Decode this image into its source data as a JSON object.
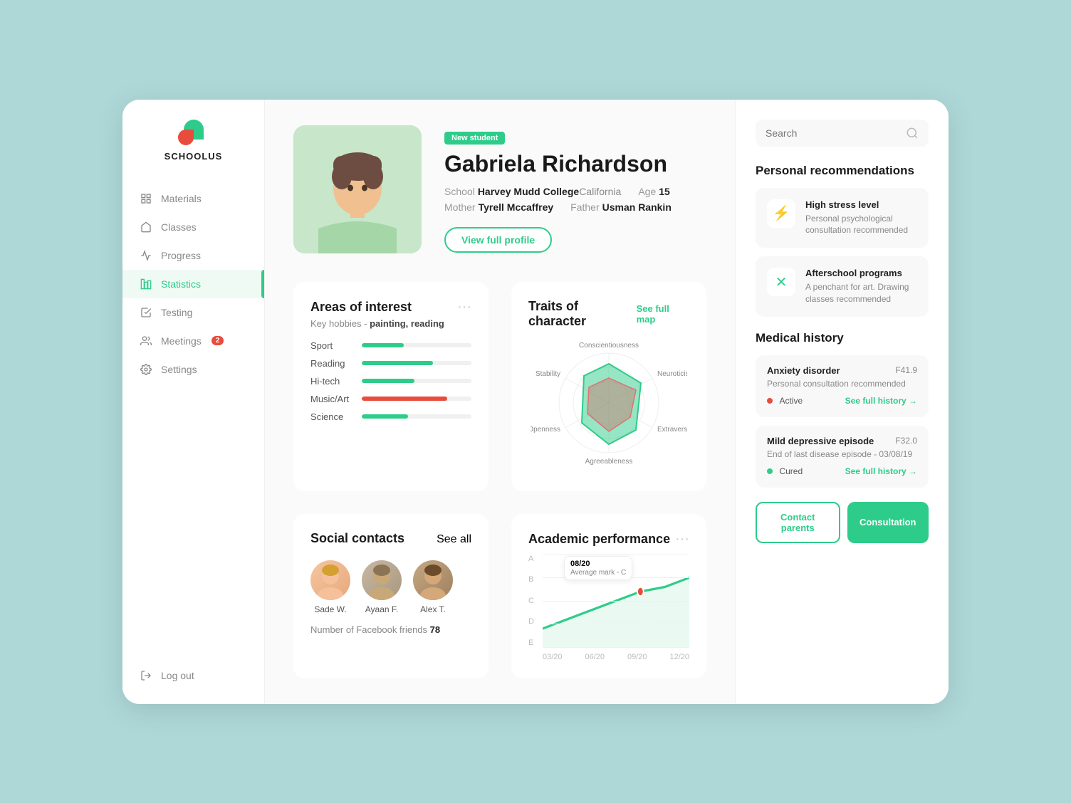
{
  "app": {
    "name": "SCHOOLUS"
  },
  "sidebar": {
    "items": [
      {
        "id": "materials",
        "label": "Materials",
        "active": false,
        "badge": null
      },
      {
        "id": "classes",
        "label": "Classes",
        "active": false,
        "badge": null
      },
      {
        "id": "progress",
        "label": "Progress",
        "active": false,
        "badge": null
      },
      {
        "id": "statistics",
        "label": "Statistics",
        "active": true,
        "badge": null
      },
      {
        "id": "testing",
        "label": "Testing",
        "active": false,
        "badge": null
      },
      {
        "id": "meetings",
        "label": "Meetings",
        "active": false,
        "badge": "2"
      },
      {
        "id": "settings",
        "label": "Settings",
        "active": false,
        "badge": null
      }
    ],
    "logout_label": "Log out"
  },
  "student": {
    "badge": "New student",
    "name": "Gabriela Richardson",
    "school_label": "School",
    "school": "Harvey Mudd College",
    "location": "California",
    "age_label": "Age",
    "age": "15",
    "mother_label": "Mother",
    "mother": "Tyrell Mccaffrey",
    "father_label": "Father",
    "father": "Usman Rankin",
    "view_profile_label": "View full profile"
  },
  "areas_of_interest": {
    "title": "Areas of interest",
    "hobbies_label": "Key hobbies",
    "hobbies": "painting, reading",
    "bars": [
      {
        "label": "Sport",
        "pct": 38,
        "color": "#2ecc8a"
      },
      {
        "label": "Reading",
        "pct": 65,
        "color": "#2ecc8a"
      },
      {
        "label": "Hi-tech",
        "pct": 48,
        "color": "#2ecc8a"
      },
      {
        "label": "Music/Art",
        "pct": 78,
        "color": "#e74c3c"
      },
      {
        "label": "Science",
        "pct": 42,
        "color": "#2ecc8a"
      }
    ]
  },
  "traits": {
    "title": "Traits of character",
    "see_full_map": "See full map",
    "labels": [
      "Conscientiousness",
      "Neuroticism",
      "Extraversion",
      "Agreeableness",
      "Openness",
      "Stability"
    ]
  },
  "social": {
    "title": "Social contacts",
    "see_all": "See all",
    "contacts": [
      {
        "name": "Sade W."
      },
      {
        "name": "Ayaan F."
      },
      {
        "name": "Alex T."
      }
    ],
    "facebook_label": "Number of Facebook friends",
    "facebook_count": "78"
  },
  "academic": {
    "title": "Academic performance",
    "mark": "08/20",
    "average_label": "Average mark",
    "average": "C",
    "x_labels": [
      "03/20",
      "06/20",
      "09/20",
      "12/20"
    ],
    "y_labels": [
      "A",
      "B",
      "C",
      "D",
      "E"
    ]
  },
  "right_panel": {
    "search_placeholder": "Search",
    "recommendations_title": "Personal recommendations",
    "recommendations": [
      {
        "id": "stress",
        "icon": "⚡",
        "title": "High stress level",
        "desc": "Personal psychological consultation recommended"
      },
      {
        "id": "afterschool",
        "icon": "✕",
        "title": "Afterschool programs",
        "desc": "A penchant for art. Drawing classes recommended"
      }
    ],
    "medical_title": "Medical history",
    "medical_records": [
      {
        "title": "Anxiety disorder",
        "code": "F41.9",
        "desc": "Personal consultation recommended",
        "status": "Active",
        "status_type": "active",
        "history_link": "See full history →"
      },
      {
        "title": "Mild depressive episode",
        "code": "F32.0",
        "desc": "End of last disease episode - 03/08/19",
        "status": "Cured",
        "status_type": "cured",
        "history_link": "See full history →"
      }
    ],
    "btn_contact": "Contact parents",
    "btn_consultation": "Consultation"
  }
}
